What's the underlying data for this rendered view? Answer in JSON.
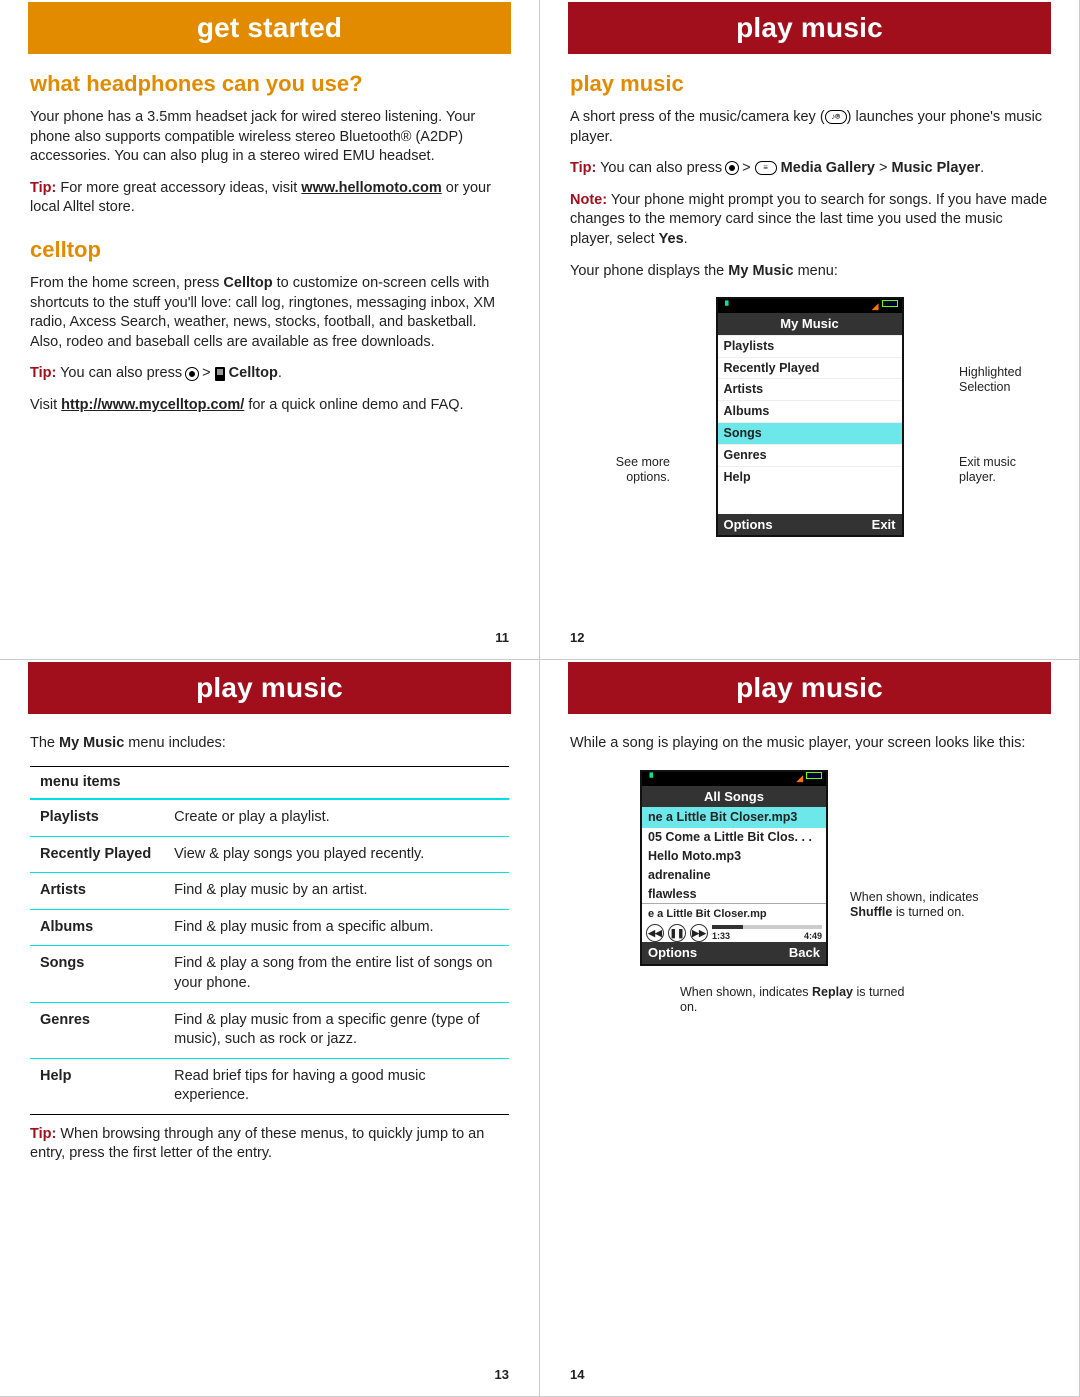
{
  "p11": {
    "banner": "get started",
    "h_headphones": "what headphones can you use?",
    "headphones_body": "Your phone has a 3.5mm headset jack for wired stereo listening. Your phone also supports compatible wireless stereo Bluetooth® (A2DP) accessories. You can also plug in a stereo wired EMU headset.",
    "tip1_pre": "Tip:",
    "tip1_body_a": " For more great accessory ideas, visit ",
    "tip1_link": "www.hellomoto.com",
    "tip1_body_b": " or your local Alltel store.",
    "h_celltop": "celltop",
    "celltop_body": "From the home screen, press ",
    "celltop_key": "Celltop",
    "celltop_body_b": " to customize on-screen cells with shortcuts to the stuff you'll love: call log, ringtones, messaging inbox, XM radio, Axcess Search, weather, news, stocks, football, and basketball. Also, rodeo and baseball cells are available as free downloads.",
    "tip2_body": " You can also press ",
    "tip2_key": "Celltop",
    "tip2_after": ".",
    "visit_a": "Visit ",
    "visit_link": "http://www.mycelltop.com/",
    "visit_b": " for a quick online demo and FAQ.",
    "pagenum": "11"
  },
  "p12": {
    "banner": "play music",
    "h": "play music",
    "intro_a": "A short press of the music/camera key (",
    "intro_b": ") launches your phone's music player.",
    "tip_body": " You can also press ",
    "tip_path_a": "Media Gallery",
    "tip_path_b": "Music Player",
    "note_body": " Your phone might prompt you to search for songs. If you have made changes to the memory card since the last time you used the music player, select ",
    "note_yes": "Yes",
    "displays": "Your phone displays the ",
    "mymusic": "My Music",
    "displays_b": " menu:",
    "phone": {
      "title": "My Music",
      "items": [
        "Playlists",
        "Recently Played",
        "Artists",
        "Albums",
        "Songs",
        "Genres",
        "Help"
      ],
      "soft_left": "Options",
      "soft_right": "Exit"
    },
    "call_hl": "Highlighted Selection",
    "call_exit": "Exit music player.",
    "call_opts": "See more options.",
    "pagenum": "12"
  },
  "p13": {
    "banner": "play music",
    "intro_a": "The ",
    "intro_bold": "My Music",
    "intro_b": " menu includes:",
    "th": "menu items",
    "rows": [
      {
        "k": "Playlists",
        "v": "Create or play a playlist."
      },
      {
        "k": "Recently Played",
        "v": "View & play songs you played recently."
      },
      {
        "k": "Artists",
        "v": "Find & play music by an artist."
      },
      {
        "k": "Albums",
        "v": "Find & play music from a specific album."
      },
      {
        "k": "Songs",
        "v": "Find & play a song from the entire list of songs on your phone."
      },
      {
        "k": "Genres",
        "v": "Find & play music from a specific genre (type of music), such as rock or jazz."
      },
      {
        "k": "Help",
        "v": "Read brief tips for having a good music experience."
      }
    ],
    "tip_body": " When browsing through any of these menus, to quickly jump to an entry, press the first letter of the entry.",
    "pagenum": "13"
  },
  "p14": {
    "banner": "play music",
    "intro": "While a song is playing on the music player, your screen looks like this:",
    "phone": {
      "title": "All Songs",
      "nowbar": "ne a Little Bit Closer.mp3",
      "tracks": [
        "05 Come a Little Bit Clos. . .",
        "Hello Moto.mp3",
        "adrenaline",
        "flawless"
      ],
      "nowplaying": "e a Little Bit Closer.mp",
      "elapsed": "1:33",
      "total": "4:49",
      "soft_left": "Options",
      "soft_right": "Back"
    },
    "call_shuffle_a": "When shown, indicates ",
    "call_shuffle_b": "Shuffle",
    "call_shuffle_c": " is turned on.",
    "call_replay_a": "When shown, indicates ",
    "call_replay_b": "Replay",
    "call_replay_c": " is turned on.",
    "pagenum": "14"
  },
  "labels": {
    "tip": "Tip:",
    "note": "Note:"
  }
}
